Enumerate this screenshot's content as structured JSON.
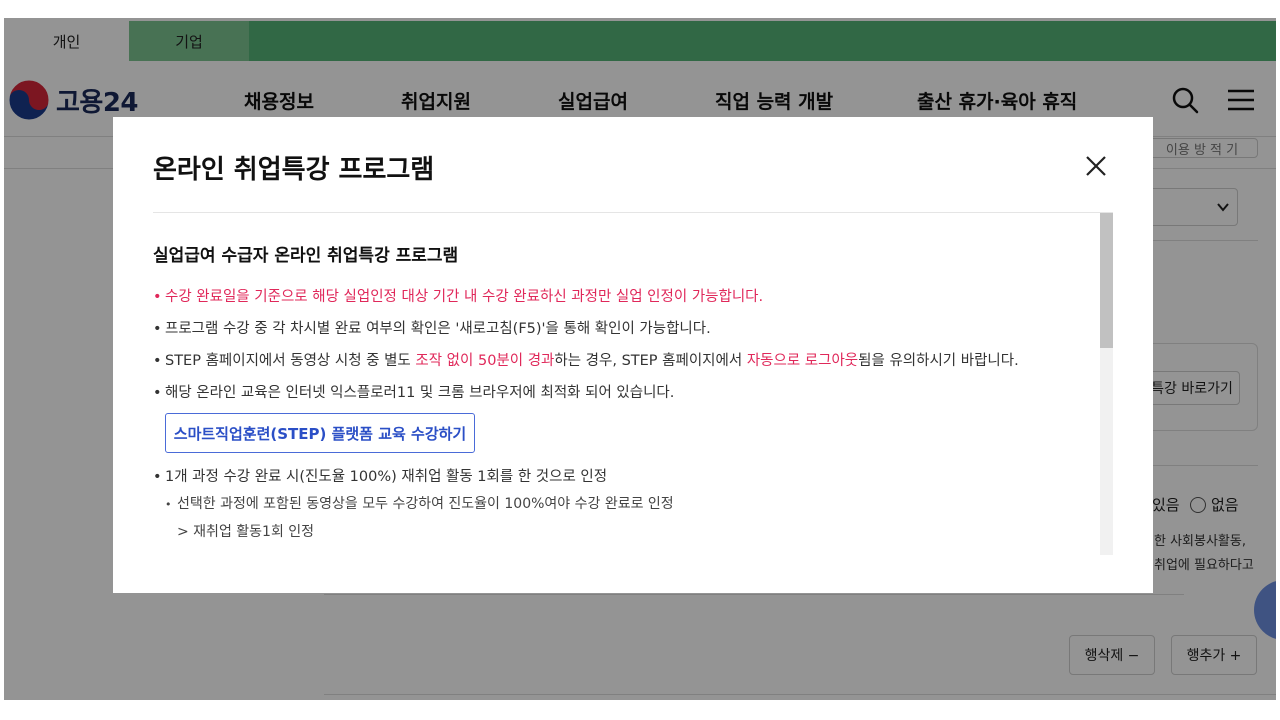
{
  "topbar": {
    "tabs": [
      {
        "label": "개인",
        "active": true
      },
      {
        "label": "기업",
        "active": false
      }
    ]
  },
  "header": {
    "logo_text": "고용24",
    "nav": [
      "채용정보",
      "취업지원",
      "실업급여",
      "직업 능력 개발",
      "출산 휴가·육아 휴직"
    ],
    "icons": [
      "search-icon",
      "menu-icon"
    ]
  },
  "background": {
    "top_right_button": "이용 방 적 기",
    "shortcut_button": "특강 바로가기",
    "radio_yes": "있음",
    "radio_no": "없음",
    "note_line1": "한 사회봉사활동,",
    "note_line2": "취업에 필요하다고",
    "delete_row_button": "행삭제 −",
    "add_row_button": "행추가 +"
  },
  "modal": {
    "title": "온라인 취업특강 프로그램",
    "subtitle": "실업급여 수급자 온라인 취업특강 프로그램",
    "bullet1": "수강 완료일을 기준으로 해당 실업인정 대상 기간 내 수강 완료하신 과정만 실업 인정이 가능합니다.",
    "bullet2": "프로그램 수강 중 각 차시별 완료 여부의 확인은 '새로고침(F5)'을 통해 확인이 가능합니다.",
    "bullet3": {
      "part1": "STEP 홈페이지에서 동영상 시청 중 별도 ",
      "part2": "조작 없이 50분이 경과",
      "part3": "하는 경우, STEP 홈페이지에서 ",
      "part4": "자동으로 로그아웃",
      "part5": "됨을 유의하시기 바랍니다."
    },
    "bullet4": "해당 온라인 교육은 인터넷 익스플로러11 및 크롬 브라우저에 최적화 되어 있습니다.",
    "step_button": "스마트직업훈련(STEP) 플랫폼 교육 수강하기",
    "bullet5": "1개 과정 수강 완료 시(진도율 100%) 재취업 활동 1회를 한 것으로 인정",
    "sub_bullet": "선택한 과정에 포함된 동영상을 모두 수강하여 진도율이 100%여야 수강 완료로 인정",
    "sub_sub": "> 재취업 활동1회 인정",
    "accent_color": "#e0285a",
    "link_color": "#2b4fc6"
  }
}
